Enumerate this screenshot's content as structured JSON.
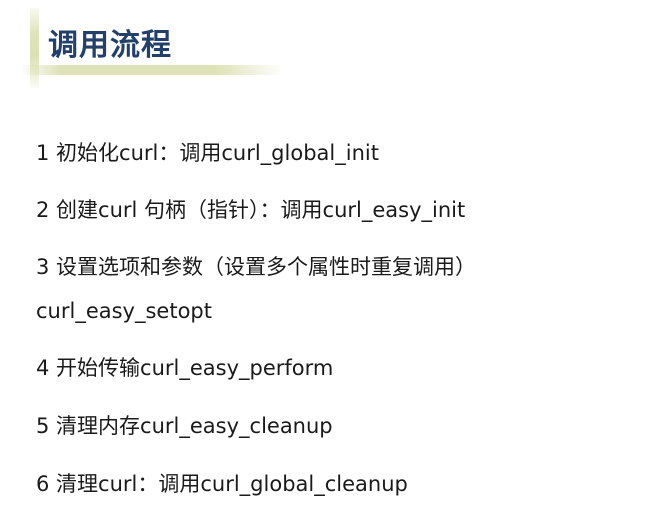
{
  "header": {
    "title": "调用流程"
  },
  "steps": [
    {
      "text": "1 初始化curl：调用curl_global_init"
    },
    {
      "text": "2 创建curl 句柄（指针）：调用curl_easy_init"
    },
    {
      "text": "3  设置选项和参数（设置多个属性时重复调用）",
      "continuation": "curl_easy_setopt"
    },
    {
      "text": "4 开始传输curl_easy_perform"
    },
    {
      "text": "5 清理内存curl_easy_cleanup"
    },
    {
      "text": "6 清理curl：调用curl_global_cleanup"
    }
  ],
  "colors": {
    "title": "#23406b",
    "accent": "#d6dba6",
    "text": "#1a1a1a"
  }
}
